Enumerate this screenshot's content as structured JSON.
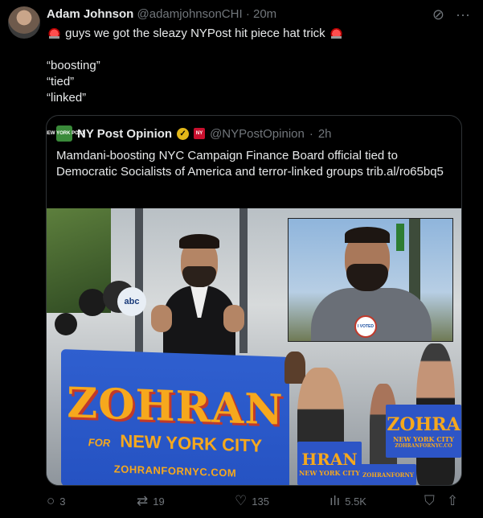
{
  "tweet": {
    "author_name": "Adam Johnson",
    "author_handle": "@adamjohnsonCHI",
    "separator": "·",
    "time": "20m",
    "text_line1": "guys we got the sleazy NYPost hit piece hat trick",
    "text_line2": "“boosting”",
    "text_line3": "“tied”",
    "text_line4": "“linked”"
  },
  "quote": {
    "logo_text": "NEW YORK POST",
    "author_name": "NY Post Opinion",
    "author_handle": "@NYPostOpinion",
    "separator": "·",
    "time": "2h",
    "text": "Mamdani-boosting NYC Campaign Finance Board official tied to Democratic Socialists of America and terror-linked groups trib.al/ro65bq5"
  },
  "media": {
    "podium_big": "ZOHRAN",
    "podium_for": "FOR",
    "podium_city": "NEW YORK CITY",
    "podium_web": "ZOHRANFORNYC.COM",
    "inset_sticker": "I VOTED",
    "sign1_big": "ZOHRA",
    "sign1_sub": "NEW YORK CITY",
    "sign1_web": "ZOHRANFORNYC.CO",
    "sign2_big": "HRAN",
    "sign2_sub": "NEW YORK CITY",
    "sign3_web": "ZOHRANFORNY",
    "mic_label": "abc"
  },
  "actions": {
    "replies": "3",
    "reposts": "19",
    "likes": "135",
    "views": "5.5K"
  },
  "colors": {
    "background": "#000000",
    "text": "#e7e9ea",
    "muted": "#71767b",
    "border": "#2f3336",
    "campaign_blue": "#2d55c6",
    "campaign_gold": "#f6a81d"
  }
}
